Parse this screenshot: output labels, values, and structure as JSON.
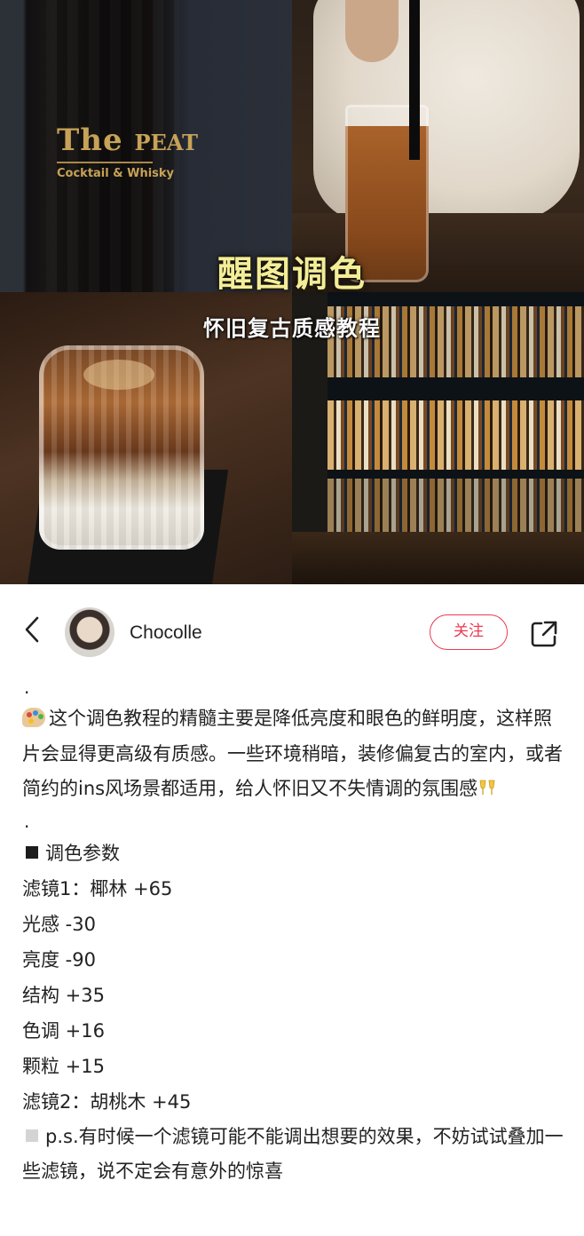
{
  "cover": {
    "title": "醒图调色",
    "subtitle": "怀旧复古质感教程",
    "sign_text_main": "The PEAT",
    "sign_text_sub": "Cocktail & Whisky"
  },
  "author": {
    "name": "Chocolle",
    "follow_label": "关注"
  },
  "icons": {
    "back": "chevron-left-icon",
    "share": "share-icon",
    "palette": "palette-emoji",
    "cheers": "clinking-glasses-emoji"
  },
  "colors": {
    "accent": "#ea3b52",
    "title_yellow": "#f4ed98"
  },
  "post": {
    "dot1": ".",
    "intro": "这个调色教程的精髓主要是降低亮度和眼色的鲜明度，这样照片会显得更高级有质感。一些环境稍暗，装修偏复古的室内，或者简约的ins风场景都适用，给人怀旧又不失情调的氛围感",
    "dot2": ".",
    "params_header": "调色参数",
    "params": [
      "滤镜1：椰林 +65",
      "光感 -30",
      "亮度 -90",
      "结构 +35",
      "色调 +16",
      "颗粒 +15",
      "滤镜2：胡桃木 +45"
    ],
    "note": "p.s.有时候一个滤镜可能不能调出想要的效果，不妨试试叠加一些滤镜，说不定会有意外的惊喜"
  }
}
